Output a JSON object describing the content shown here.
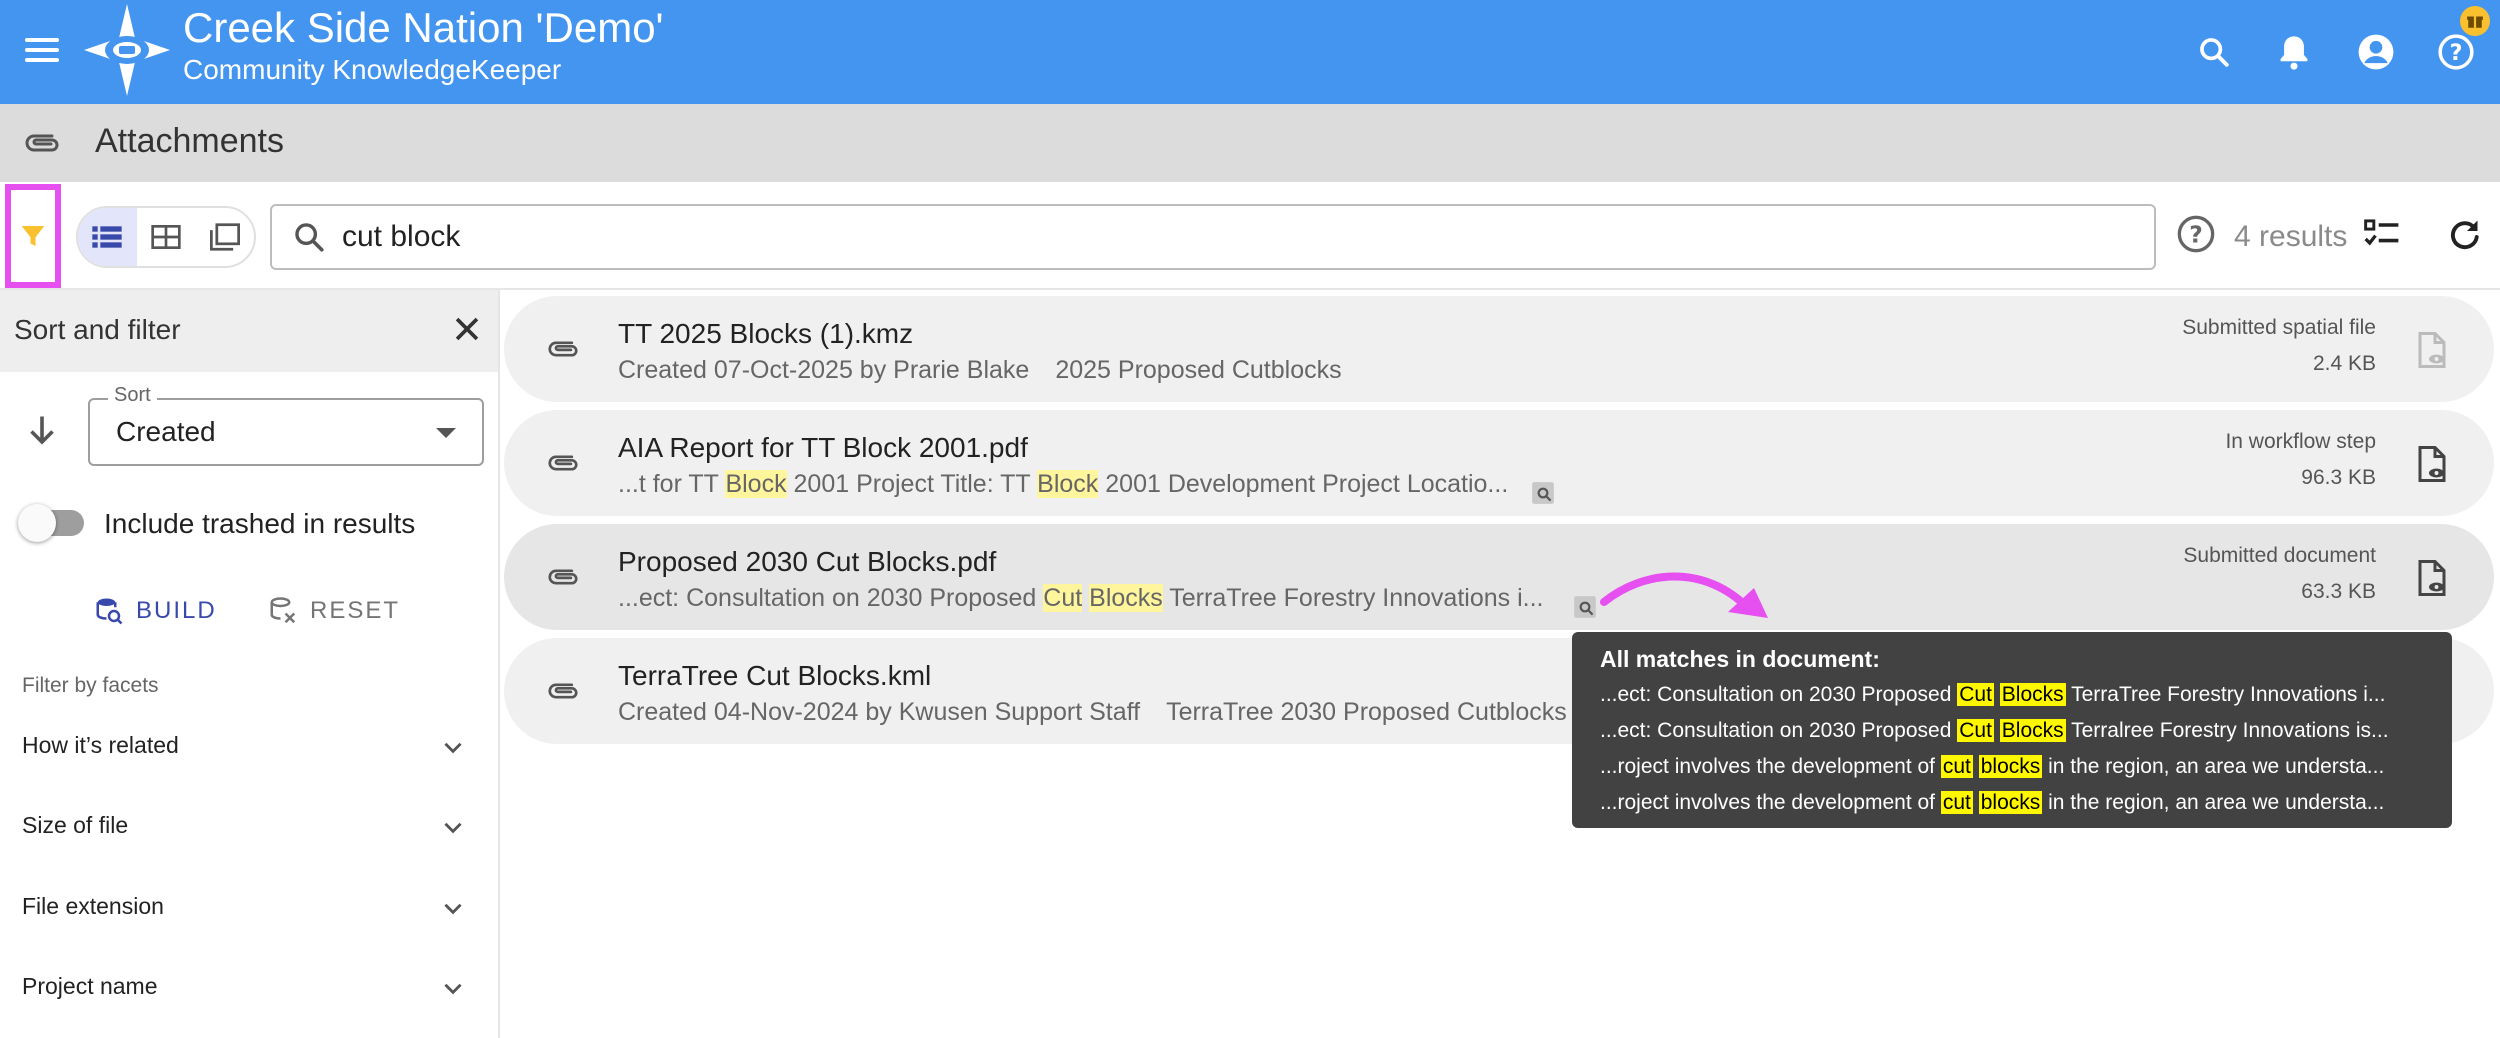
{
  "header": {
    "title": "Creek Side Nation 'Demo'",
    "subtitle": "Community KnowledgeKeeper",
    "icons": [
      "menu-icon",
      "search-icon",
      "bell-icon",
      "account-icon",
      "help-icon",
      "gift-icon"
    ]
  },
  "page": {
    "title": "Attachments",
    "icon": "paperclip-icon"
  },
  "toolbar": {
    "search_value": "cut block",
    "result_count": "4 results"
  },
  "sidebar": {
    "title": "Sort and filter",
    "sort_label": "Sort",
    "sort_value": "Created",
    "include_trashed_label": "Include trashed in results",
    "include_trashed": false,
    "build_label": "BUILD",
    "reset_label": "RESET",
    "facets_title": "Filter by facets",
    "facets": [
      "How it’s related",
      "Size of file",
      "File extension",
      "Project name"
    ]
  },
  "results": [
    {
      "name": "TT 2025 Blocks (1).kmz",
      "meta_parts": [
        "Created 07-Oct-2025 by Prarie Blake",
        "2025 Proposed Cutblocks"
      ],
      "status": "Submitted spatial file",
      "size": "2.4 KB"
    },
    {
      "name": "AIA Report for TT Block 2001.pdf",
      "snippet": [
        "...t for TT ",
        "Block",
        " 2001 Project Title: TT ",
        "Block",
        " 2001 Development Project Locatio..."
      ],
      "status": "In workflow step",
      "size": "96.3 KB"
    },
    {
      "name": "Proposed 2030 Cut Blocks.pdf",
      "snippet": [
        "...ect: Consultation on 2030 Proposed ",
        "Cut",
        " ",
        "Blocks",
        " TerraTree Forestry Innovations i..."
      ],
      "status": "Submitted document",
      "size": "63.3 KB"
    },
    {
      "name": "TerraTree Cut Blocks.kml",
      "meta_parts": [
        "Created 04-Nov-2024 by Kwusen Support Staff",
        "TerraTree 2030 Proposed Cutblocks"
      ]
    }
  ],
  "tooltip": {
    "title": "All matches in document:",
    "lines": [
      [
        "...ect: Consultation on 2030 Proposed ",
        "Cut",
        " ",
        "Blocks",
        " TerraTree Forestry Innovations i..."
      ],
      [
        "...ect: Consultation on 2030 Proposed ",
        "Cut",
        " ",
        "Blocks",
        " Terralree Forestry Innovations is..."
      ],
      [
        "...roject involves the development of ",
        "cut",
        " ",
        "blocks",
        " in the region, an area we understa..."
      ],
      [
        "...roject involves the development of ",
        "cut",
        " ",
        "blocks",
        " in the region, an area we understa..."
      ]
    ]
  },
  "colors": {
    "appbar": "#4395f0",
    "highlight_box": "#e64ff0",
    "filter_icon": "#fbc02d",
    "accent": "#3949ab"
  }
}
